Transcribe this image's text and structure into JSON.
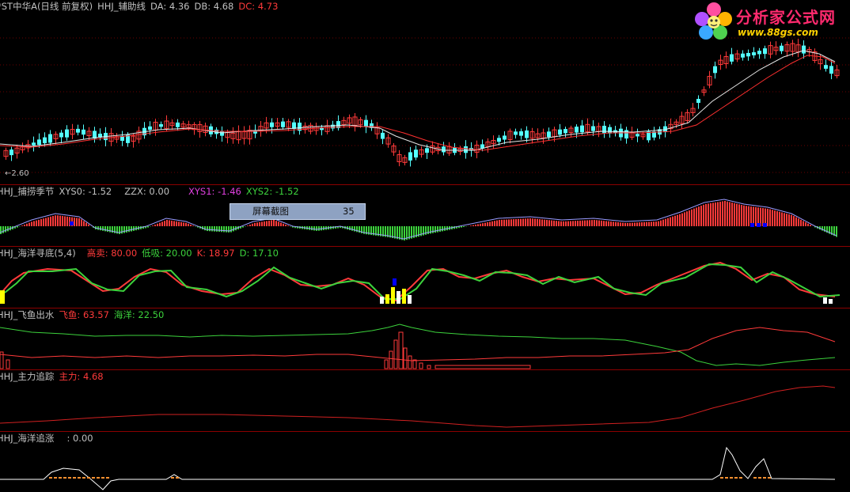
{
  "main_panel": {
    "stock_name": "*ST中华A(日线 前复权)",
    "indicator": "HHJ_辅助线",
    "da": "DA: 4.36",
    "db": "DB: 4.68",
    "dc": "DC: 4.73",
    "low_marker": "←2.60"
  },
  "panel2": {
    "name": "HHJ_捕捞季节",
    "xys0": "XYS0: -1.52",
    "zzx": "ZZX: 0.00",
    "xys1": "XYS1: -1.46",
    "xys2": "XYS2: -1.52"
  },
  "tooltip": {
    "label": "屏幕截图",
    "value": "35"
  },
  "panel3": {
    "name": "HHJ_海洋寻底(5,4)",
    "gaomai": "高卖: 80.00",
    "dixi": "低吸: 20.00",
    "k": "K: 18.97",
    "d": "D: 17.10"
  },
  "panel4": {
    "name": "HHJ_飞鱼出水",
    "feiyu": "飞鱼: 63.57",
    "haiyang": "海洋: 22.50"
  },
  "panel5": {
    "name": "HHJ_主力追踪",
    "zhuli": "主力: 4.68"
  },
  "panel6": {
    "name": "HHJ_海洋追涨",
    "value": ": 0.00"
  },
  "logo": {
    "title": "分析家公式网",
    "url": "www.88gs.com"
  },
  "colors": {
    "background": "#000000",
    "separator": "#8b0000",
    "up": "#ff3a3a",
    "down": "#54ffff",
    "ma_white": "#e6e6e6",
    "ma_red": "#ff3030",
    "green": "#3cd23c",
    "yellow": "#ffff00",
    "blue": "#0000ff"
  }
}
